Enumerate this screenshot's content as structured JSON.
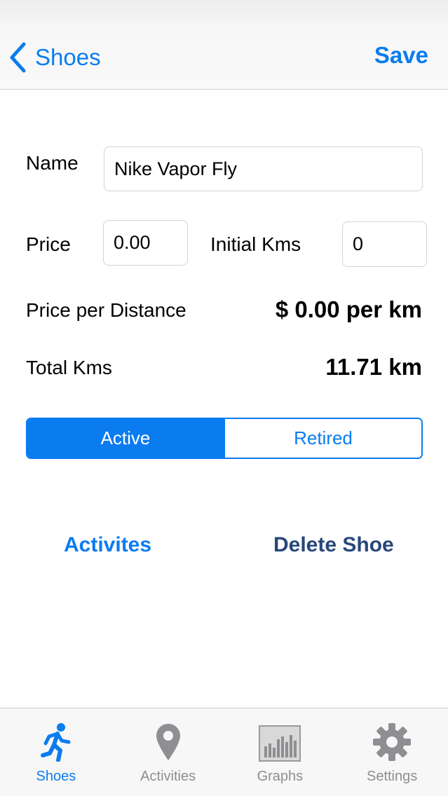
{
  "navbar": {
    "back_label": "Shoes",
    "save_label": "Save"
  },
  "form": {
    "name_label": "Name",
    "name_value": "Nike Vapor Fly",
    "price_label": "Price",
    "price_value": "0.00",
    "initial_kms_label": "Initial Kms",
    "initial_kms_value": "0",
    "price_per_distance_label": "Price per Distance",
    "price_per_distance_value": "$ 0.00 per km",
    "total_kms_label": "Total Kms",
    "total_kms_value": "11.71 km"
  },
  "status": {
    "options": [
      "Active",
      "Retired"
    ],
    "selected": "Active"
  },
  "actions": {
    "activities_label": "Activites",
    "delete_label": "Delete Shoe"
  },
  "tabbar": {
    "items": [
      {
        "label": "Shoes",
        "icon": "runner-icon",
        "selected": true
      },
      {
        "label": "Activities",
        "icon": "map-pin-icon",
        "selected": false
      },
      {
        "label": "Graphs",
        "icon": "bar-graph-icon",
        "selected": false
      },
      {
        "label": "Settings",
        "icon": "gear-icon",
        "selected": false
      }
    ]
  },
  "colors": {
    "accent": "#0a7cf0",
    "delete_text": "#27477a",
    "inactive_tab": "#8e8e93"
  }
}
